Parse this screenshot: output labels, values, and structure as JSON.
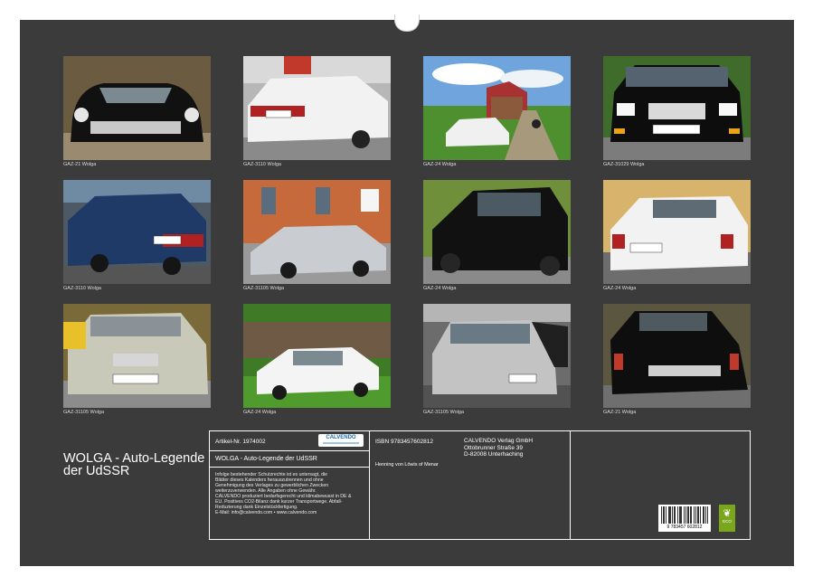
{
  "calendar": {
    "title": "WOLGA - Auto-Legende der UdSSR",
    "photos": [
      {
        "caption": "GAZ-21 Wolga"
      },
      {
        "caption": "GAZ-3110 Wolga"
      },
      {
        "caption": "GAZ-24 Wolga"
      },
      {
        "caption": "GAZ-31029 Wolga"
      },
      {
        "caption": "GAZ-3110 Wolga"
      },
      {
        "caption": "GAZ-31105 Wolga"
      },
      {
        "caption": "GAZ-24 Wolga"
      },
      {
        "caption": "GAZ-24 Wolga"
      },
      {
        "caption": "GAZ-31105 Wolga"
      },
      {
        "caption": "GAZ-24 Wolga"
      },
      {
        "caption": "GAZ-31105 Wolga"
      },
      {
        "caption": "GAZ-21 Wolga"
      }
    ]
  },
  "info": {
    "article_no": "Artikel-Nr. 1974002",
    "logo_text": "CALVENDO",
    "product_title": "WOLGA - Auto-Legende der UdSSR",
    "legal_text": "Infolge bestehender Schutzrechte ist es untersagt, die\nBlätter dieses Kalenders herauszutrennen und ohne\nGenehmigung des Verlages zu gewerblichen Zwecken\nweiterzuverwenden. Alle Angaben ohne Gewähr.\nCALVENDO produziert bedarfsgerecht und klimabewusst in DE &\nEU. Positives CO2-Bilanz dank kurzer Transportwege. Abfall-\nReduzierung dank Einzelstückfertigung.\nE-Mail: info@calvendo.com • www.calvendo.com",
    "isbn": "ISBN 9783457602812",
    "author": "Henning von Löwis of Menar",
    "publisher": [
      "CALVENDO Verlag GmbH",
      "Ottobrunner Straße 39",
      "D-82008 Unterhaching"
    ],
    "barcode_number": "9 783457 602812",
    "eco_label": "ECO"
  }
}
